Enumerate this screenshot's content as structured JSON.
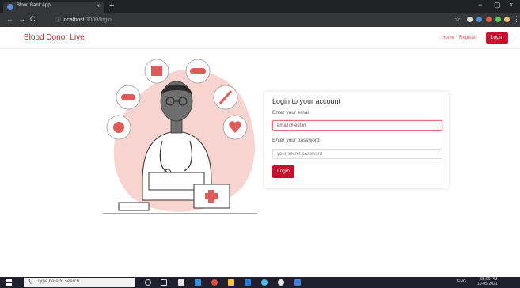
{
  "browser": {
    "tab_title": "Blood Bank App",
    "tab_close": "×",
    "new_tab": "+",
    "url_host": "localhost",
    "url_path": ":3000/login",
    "controls": {
      "back": "←",
      "forward": "→",
      "reload": "C",
      "info": "ⓘ",
      "minimize": "−",
      "maximize": "▢",
      "close": "×",
      "star": "☆",
      "menu": "⋮"
    }
  },
  "navbar": {
    "brand": "Blood Donor Live",
    "home": "Home",
    "register": "Register",
    "login": "Login"
  },
  "login_card": {
    "title": "Login to your account",
    "email_label": "Enter your email",
    "email_value": "email@test.in",
    "password_label": "Enter your password",
    "password_placeholder": "your secret password",
    "submit": "Login"
  },
  "taskbar": {
    "search_placeholder": "Type here to search",
    "search_icon": "⚲",
    "tray_time": "05:00 PM",
    "tray_date": "10-05-2021",
    "tray_lang": "ENG"
  },
  "colors": {
    "brand": "#c2242f",
    "button": "#c8102e",
    "blob": "#f8d4d0"
  }
}
